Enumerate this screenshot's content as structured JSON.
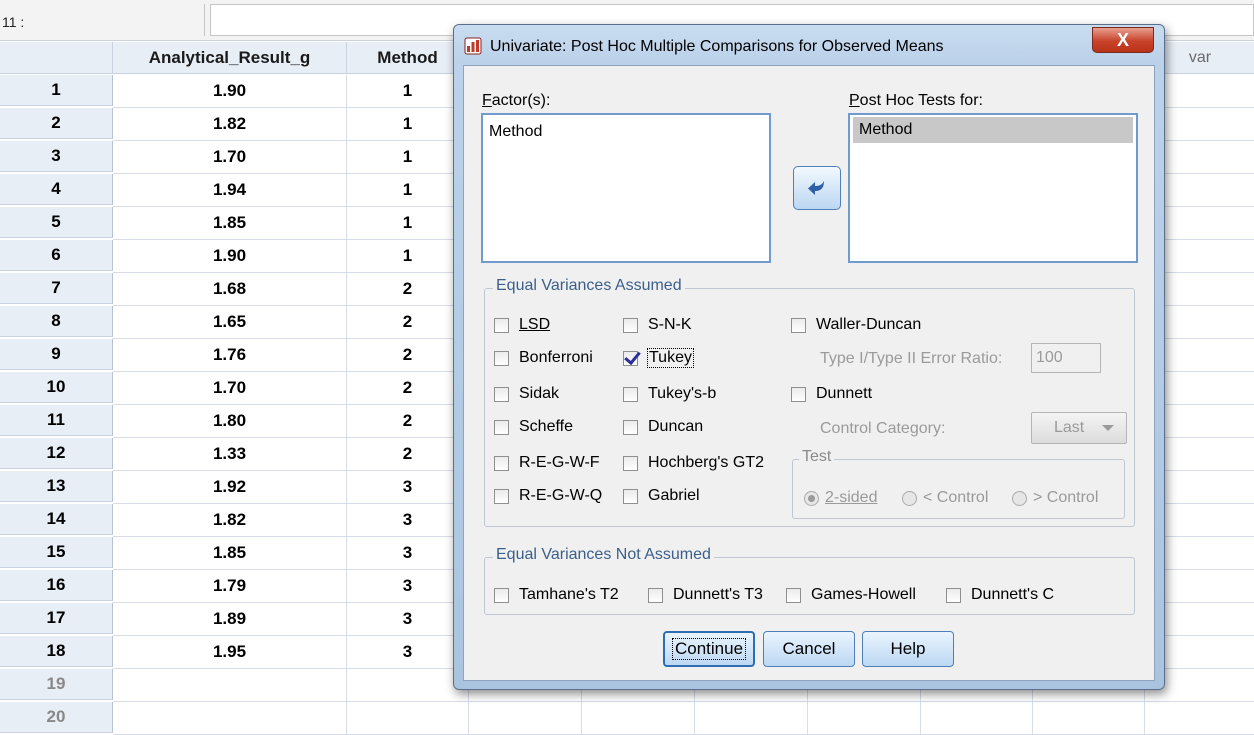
{
  "cell_ref": "11 :",
  "spreadsheet": {
    "columns": [
      "Analytical_Result_g",
      "Method",
      "var"
    ],
    "rows": [
      {
        "n": "1",
        "result": "1.90",
        "method": "1"
      },
      {
        "n": "2",
        "result": "1.82",
        "method": "1"
      },
      {
        "n": "3",
        "result": "1.70",
        "method": "1"
      },
      {
        "n": "4",
        "result": "1.94",
        "method": "1"
      },
      {
        "n": "5",
        "result": "1.85",
        "method": "1"
      },
      {
        "n": "6",
        "result": "1.90",
        "method": "1"
      },
      {
        "n": "7",
        "result": "1.68",
        "method": "2"
      },
      {
        "n": "8",
        "result": "1.65",
        "method": "2"
      },
      {
        "n": "9",
        "result": "1.76",
        "method": "2"
      },
      {
        "n": "10",
        "result": "1.70",
        "method": "2"
      },
      {
        "n": "11",
        "result": "1.80",
        "method": "2"
      },
      {
        "n": "12",
        "result": "1.33",
        "method": "2"
      },
      {
        "n": "13",
        "result": "1.92",
        "method": "3"
      },
      {
        "n": "14",
        "result": "1.82",
        "method": "3"
      },
      {
        "n": "15",
        "result": "1.85",
        "method": "3"
      },
      {
        "n": "16",
        "result": "1.79",
        "method": "3"
      },
      {
        "n": "17",
        "result": "1.89",
        "method": "3"
      },
      {
        "n": "18",
        "result": "1.95",
        "method": "3"
      },
      {
        "n": "19",
        "result": "",
        "method": ""
      },
      {
        "n": "20",
        "result": "",
        "method": ""
      }
    ]
  },
  "dialog": {
    "title": "Univariate: Post Hoc Multiple Comparisons for Observed Means",
    "close_label": "X",
    "factors_label": "Factor(s):",
    "factors": [
      "Method"
    ],
    "posthoc_label": "Post Hoc Tests for:",
    "posthoc_items": [
      "Method"
    ],
    "equal_assumed_title": "Equal Variances Assumed",
    "tests": {
      "lsd": {
        "label": "LSD",
        "checked": false
      },
      "bonferroni": {
        "label": "Bonferroni",
        "checked": false
      },
      "sidak": {
        "label": "Sidak",
        "checked": false
      },
      "scheffe": {
        "label": "Scheffe",
        "checked": false
      },
      "regwf": {
        "label": "R-E-G-W-F",
        "checked": false
      },
      "regwq": {
        "label": "R-E-G-W-Q",
        "checked": false
      },
      "snk": {
        "label": "S-N-K",
        "checked": false
      },
      "tukey": {
        "label": "Tukey",
        "checked": true
      },
      "tukeyb": {
        "label": "Tukey's-b",
        "checked": false
      },
      "duncan": {
        "label": "Duncan",
        "checked": false
      },
      "hochberg": {
        "label": "Hochberg's GT2",
        "checked": false
      },
      "gabriel": {
        "label": "Gabriel",
        "checked": false
      },
      "waller": {
        "label": "Waller-Duncan",
        "checked": false
      },
      "dunnett": {
        "label": "Dunnett",
        "checked": false
      }
    },
    "error_ratio_label": "Type I/Type II Error Ratio:",
    "error_ratio_value": "100",
    "control_category_label": "Control Category:",
    "control_category_value": "Last",
    "test_group_title": "Test",
    "test_options": [
      "2-sided",
      "< Control",
      "> Control"
    ],
    "test_selected": "2-sided",
    "not_assumed_title": "Equal Variances Not Assumed",
    "not_assumed_tests": {
      "tamhane": {
        "label": "Tamhane's T2",
        "checked": false
      },
      "dunnett_t3": {
        "label": "Dunnett's T3",
        "checked": false
      },
      "games_howell": {
        "label": "Games-Howell",
        "checked": false
      },
      "dunnett_c": {
        "label": "Dunnett's C",
        "checked": false
      }
    },
    "buttons": {
      "continue": "Continue",
      "cancel": "Cancel",
      "help": "Help"
    }
  },
  "colors": {
    "title_bar": "#bcd2ea",
    "close": "#c8432b",
    "grid_header": "#e8eef6"
  }
}
